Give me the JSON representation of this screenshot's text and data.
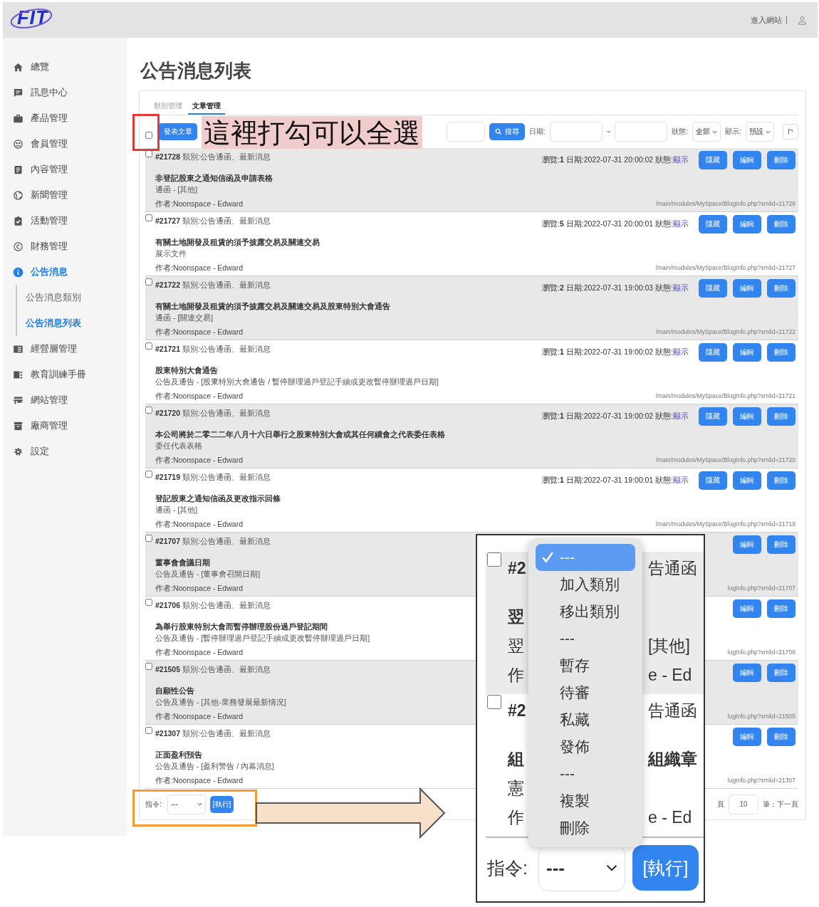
{
  "header": {
    "logo": "FIT",
    "site_link": "進入網站"
  },
  "sidebar": {
    "items": [
      {
        "label": "總覽",
        "selected": false
      },
      {
        "label": "訊息中心",
        "selected": false
      },
      {
        "label": "產品管理",
        "selected": false
      },
      {
        "label": "會員管理",
        "selected": false
      },
      {
        "label": "內容管理",
        "selected": false
      },
      {
        "label": "新聞管理",
        "selected": false
      },
      {
        "label": "活動管理",
        "selected": false
      },
      {
        "label": "財務管理",
        "selected": false
      },
      {
        "label": "公告消息",
        "selected": true,
        "children": [
          {
            "label": "公告消息類別",
            "selected": false
          },
          {
            "label": "公告消息列表",
            "selected": true
          }
        ]
      },
      {
        "label": "經營層管理",
        "selected": false
      },
      {
        "label": "教育訓練手冊",
        "selected": false
      },
      {
        "label": "網站管理",
        "selected": false
      },
      {
        "label": "廠商管理",
        "selected": false
      },
      {
        "label": "設定",
        "selected": false
      }
    ]
  },
  "page_title": "公告消息列表",
  "tabs": [
    {
      "label": "類別管理",
      "selected": false
    },
    {
      "label": "文章管理",
      "selected": true
    }
  ],
  "toolbar": {
    "select_all_checked": false,
    "new_post": "發表文章",
    "search_button": "搜尋",
    "date_label": "日期:",
    "date_separator": "~",
    "status_label": "狀態:",
    "status_value": "全部",
    "display_label": "顯示:",
    "display_value": "預設"
  },
  "posts": [
    {
      "checked": false,
      "id": "#21728",
      "category": "類別:公告通函、最新消息",
      "meta": "瀏覽:**1** 日期:2022-07-31 20:00:02 狀態:",
      "status": "顯示",
      "buttons": [
        "隱藏",
        "編輯",
        "刪除"
      ],
      "title": "非登記股東之通知信函及申請表格",
      "subtitle": "通函 - [其他]",
      "author": "作者:Noonspace - Edward",
      "url": "/main/modules/MySpace/BlogInfo.php?xmlid=21728"
    },
    {
      "checked": false,
      "id": "#21727",
      "category": "類別:公告通函、最新消息",
      "meta": "瀏覽:**5** 日期:2022-07-31 20:00:01 狀態:",
      "status": "顯示",
      "buttons": [
        "隱藏",
        "編輯",
        "刪除"
      ],
      "title": "有關土地開發及租賃的須予披露交易及關連交易",
      "subtitle": "展示文件",
      "author": "作者:Noonspace - Edward",
      "url": "/main/modules/MySpace/BlogInfo.php?xmlid=21727"
    },
    {
      "checked": false,
      "id": "#21722",
      "category": "類別:公告通函、最新消息",
      "meta": "瀏覽:**2** 日期:2022-07-31 19:00:03 狀態:",
      "status": "顯示",
      "buttons": [
        "隱藏",
        "編輯",
        "刪除"
      ],
      "title": "有關土地開發及租賃的須予披露交易及關連交易及股東特別大會通告",
      "subtitle": "通函 - [關連交易]",
      "author": "作者:Noonspace - Edward",
      "url": "/main/modules/MySpace/BlogInfo.php?xmlid=21722"
    },
    {
      "checked": false,
      "id": "#21721",
      "category": "類別:公告通函、最新消息",
      "meta": "瀏覽:**1** 日期:2022-07-31 19:00:02 狀態:",
      "status": "顯示",
      "buttons": [
        "隱藏",
        "編輯",
        "刪除"
      ],
      "title": "股東特別大會通告",
      "subtitle": "公告及通告 - [股東特別大會通告 / 暫停辦理過戶登記手續或更改暫停辦理過戶日期]",
      "author": "作者:Noonspace - Edward",
      "url": "/main/modules/MySpace/BlogInfo.php?xmlid=21721"
    },
    {
      "checked": false,
      "id": "#21720",
      "category": "類別:公告通函、最新消息",
      "meta": "瀏覽:**1** 日期:2022-07-31 19:00:02 狀態:",
      "status": "顯示",
      "buttons": [
        "隱藏",
        "編輯",
        "刪除"
      ],
      "title": "本公司將於二零二二年八月十六日舉行之股東特別大會或其任何續會之代表委任表格",
      "subtitle": "委任代表表格",
      "author": "作者:Noonspace - Edward",
      "url": "/main/modules/MySpace/BlogInfo.php?xmlid=21720"
    },
    {
      "checked": false,
      "id": "#21719",
      "category": "類別:公告通函、最新消息",
      "meta": "瀏覽:**1** 日期:2022-07-31 19:00:01 狀態:",
      "status": "顯示",
      "buttons": [
        "隱藏",
        "編輯",
        "刪除"
      ],
      "title": "登記股東之通知信函及更改指示回條",
      "subtitle": "通函 - [其他]",
      "author": "作者:Noonspace - Edward",
      "url": "/main/modules/MySpace/BlogInfo.php?xmlid=21719"
    },
    {
      "checked": false,
      "id": "#21707",
      "category": "類別:公告通函、最新消息",
      "buttons": [
        "編輯",
        "刪除"
      ],
      "title": "董事會會議日期",
      "subtitle": "公告及通告 - [董事會召開日期]",
      "author": "作者:Noonspace - Edward",
      "url": "logInfo.php?xmlid=21707"
    },
    {
      "checked": false,
      "id": "#21706",
      "category": "類別:公告通函、最新消息",
      "buttons": [
        "編輯",
        "刪除"
      ],
      "title": "為舉行股東特別大會而暫停辦理股份過戶登記期間",
      "subtitle": "公告及通告 - [暫停辦理過戶登記手續或更改暫停辦理過戶日期]",
      "author": "作者:Noonspace - Edward",
      "url": "logInfo.php?xmlid=21706"
    },
    {
      "checked": false,
      "id": "#21505",
      "category": "類別:公告通函、最新消息",
      "buttons": [
        "編輯",
        "刪除"
      ],
      "title": "自願性公告",
      "subtitle": "公告及通告 - [其他-業務發展最新情況]",
      "author": "作者:Noonspace - Edward",
      "url": "logInfo.php?xmlid=21505"
    },
    {
      "checked": false,
      "id": "#21307",
      "category": "類別:公告通函、最新消息",
      "buttons": [
        "編輯",
        "刪除"
      ],
      "title": "正面盈利預告",
      "subtitle": "公告及通告 - [盈利警告 / 內幕消息]",
      "author": "作者:Noonspace - Edward",
      "url": "logInfo.php?xmlid=21307"
    }
  ],
  "footer": {
    "command_label": "指令:",
    "command_value": "---",
    "execute": "[執行]",
    "per_page_prefix": "頁",
    "per_page": "10",
    "per_page_suffix": "筆：下一頁"
  },
  "annotations": {
    "callout": "這裡打勾可以全選"
  },
  "zoom_inset": {
    "rows": [
      {
        "checked": false,
        "lines": [
          {
            "kind": "head",
            "left": "#2",
            "right": "告通函"
          },
          {
            "kind": "title",
            "left": "翌"
          },
          {
            "kind": "sub",
            "left": "翌",
            "right": "[其他]"
          },
          {
            "kind": "author",
            "left": "作",
            "right": "e - Ed"
          }
        ]
      },
      {
        "checked": false,
        "lines": [
          {
            "kind": "head",
            "left": "#2",
            "right": "告通函"
          },
          {
            "kind": "title",
            "left": "組",
            "right": "組織章"
          },
          {
            "kind": "sub",
            "left": "憲"
          },
          {
            "kind": "author",
            "left": "作",
            "right": "e - Ed"
          }
        ]
      }
    ],
    "menu": [
      {
        "label": "---",
        "selected": true
      },
      {
        "label": "加入類別",
        "selected": false
      },
      {
        "label": "移出類別",
        "selected": false
      },
      {
        "label": "---",
        "selected": false
      },
      {
        "label": "暫存",
        "selected": false
      },
      {
        "label": "待審",
        "selected": false
      },
      {
        "label": "私藏",
        "selected": false
      },
      {
        "label": "發佈",
        "selected": false
      },
      {
        "label": "---",
        "selected": false
      },
      {
        "label": "複製",
        "selected": false
      },
      {
        "label": "刪除",
        "selected": false
      }
    ],
    "command_label": "指令:",
    "command_value": "---",
    "execute": "[執行]"
  }
}
